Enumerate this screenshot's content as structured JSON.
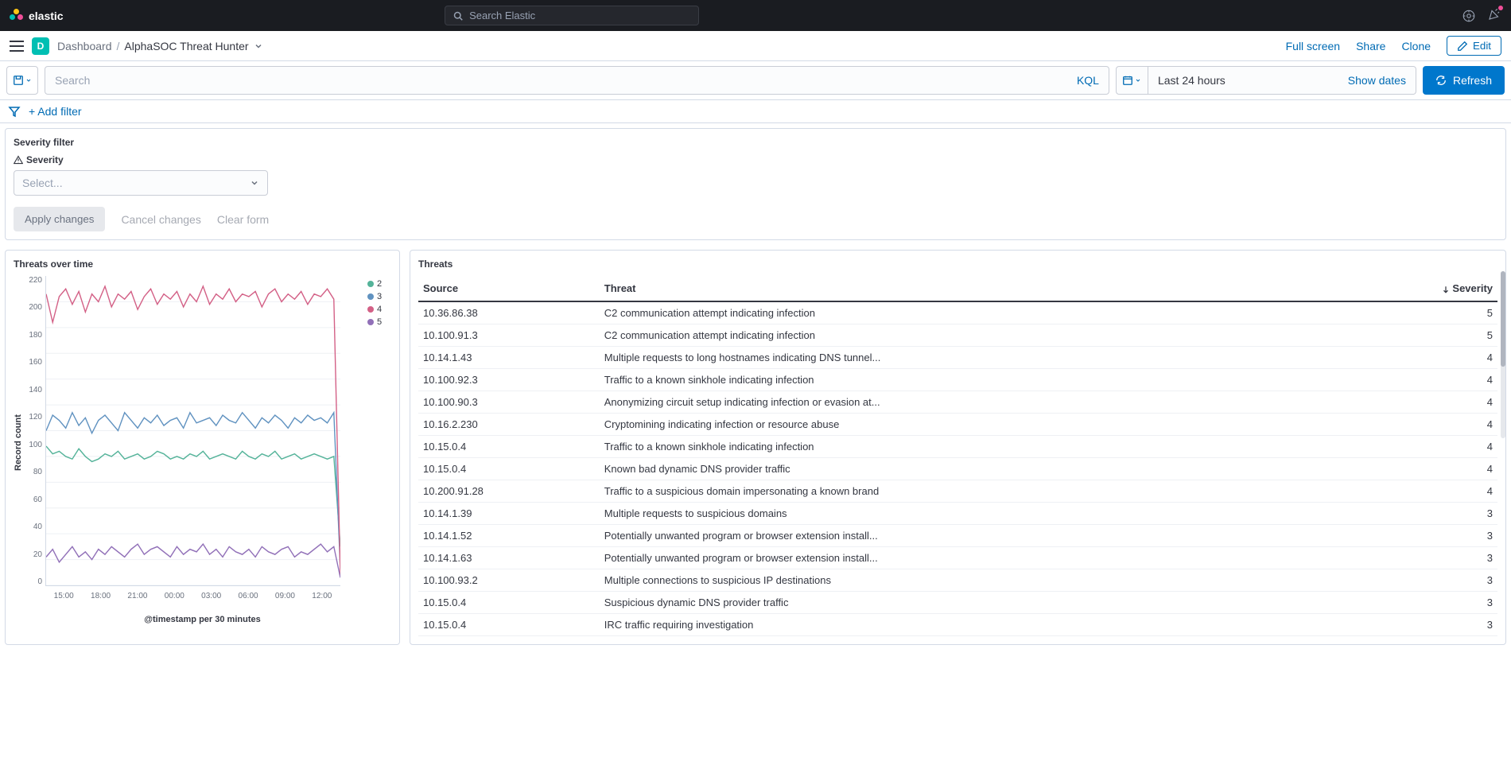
{
  "brand": "elastic",
  "top_search_placeholder": "Search Elastic",
  "space_letter": "D",
  "breadcrumb": {
    "dashboard": "Dashboard",
    "title": "AlphaSOC Threat Hunter"
  },
  "actions": {
    "fullscreen": "Full screen",
    "share": "Share",
    "clone": "Clone",
    "edit": "Edit"
  },
  "query": {
    "placeholder": "Search",
    "lang": "KQL"
  },
  "date": {
    "range": "Last 24 hours",
    "show": "Show dates"
  },
  "refresh": "Refresh",
  "add_filter": "+ Add filter",
  "severity_panel": {
    "title": "Severity filter",
    "label": "Severity",
    "placeholder": "Select...",
    "apply": "Apply changes",
    "cancel": "Cancel changes",
    "clear": "Clear form"
  },
  "chart_panel": {
    "title": "Threats over time",
    "ylabel": "Record count",
    "xlabel": "@timestamp per 30 minutes"
  },
  "threats_panel": {
    "title": "Threats",
    "columns": {
      "source": "Source",
      "threat": "Threat",
      "severity": "Severity"
    },
    "rows": [
      {
        "source": "10.36.86.38",
        "threat": "C2 communication attempt indicating infection",
        "severity": 5
      },
      {
        "source": "10.100.91.3",
        "threat": "C2 communication attempt indicating infection",
        "severity": 5
      },
      {
        "source": "10.14.1.43",
        "threat": "Multiple requests to long hostnames indicating DNS tunnel...",
        "severity": 4
      },
      {
        "source": "10.100.92.3",
        "threat": "Traffic to a known sinkhole indicating infection",
        "severity": 4
      },
      {
        "source": "10.100.90.3",
        "threat": "Anonymizing circuit setup indicating infection or evasion at...",
        "severity": 4
      },
      {
        "source": "10.16.2.230",
        "threat": "Cryptomining indicating infection or resource abuse",
        "severity": 4
      },
      {
        "source": "10.15.0.4",
        "threat": "Traffic to a known sinkhole indicating infection",
        "severity": 4
      },
      {
        "source": "10.15.0.4",
        "threat": "Known bad dynamic DNS provider traffic",
        "severity": 4
      },
      {
        "source": "10.200.91.28",
        "threat": "Traffic to a suspicious domain impersonating a known brand",
        "severity": 4
      },
      {
        "source": "10.14.1.39",
        "threat": "Multiple requests to suspicious domains",
        "severity": 3
      },
      {
        "source": "10.14.1.52",
        "threat": "Potentially unwanted program or browser extension install...",
        "severity": 3
      },
      {
        "source": "10.14.1.63",
        "threat": "Potentially unwanted program or browser extension install...",
        "severity": 3
      },
      {
        "source": "10.100.93.2",
        "threat": "Multiple connections to suspicious IP destinations",
        "severity": 3
      },
      {
        "source": "10.15.0.4",
        "threat": "Suspicious dynamic DNS provider traffic",
        "severity": 3
      },
      {
        "source": "10.15.0.4",
        "threat": "IRC traffic requiring investigation",
        "severity": 3
      }
    ]
  },
  "chart_data": {
    "type": "line",
    "xlabel": "@timestamp per 30 minutes",
    "ylabel": "Record count",
    "ylim": [
      0,
      240
    ],
    "x_ticks": [
      "15:00",
      "18:00",
      "21:00",
      "00:00",
      "03:00",
      "06:00",
      "09:00",
      "12:00"
    ],
    "y_ticks": [
      0,
      20,
      40,
      60,
      80,
      100,
      120,
      140,
      160,
      180,
      200,
      220
    ],
    "legend": [
      {
        "name": "2",
        "color": "#54b399"
      },
      {
        "name": "3",
        "color": "#6092c0"
      },
      {
        "name": "4",
        "color": "#d36086"
      },
      {
        "name": "5",
        "color": "#9170b8"
      }
    ],
    "series": [
      {
        "name": "2",
        "color": "#54b399",
        "values": [
          108,
          102,
          104,
          100,
          98,
          106,
          100,
          96,
          98,
          102,
          100,
          104,
          98,
          100,
          102,
          98,
          100,
          104,
          102,
          98,
          100,
          98,
          102,
          100,
          104,
          98,
          100,
          102,
          100,
          98,
          104,
          100,
          98,
          102,
          100,
          104,
          98,
          100,
          102,
          98,
          100,
          102,
          100,
          98,
          100,
          30
        ]
      },
      {
        "name": "3",
        "color": "#6092c0",
        "values": [
          120,
          132,
          128,
          122,
          134,
          124,
          130,
          118,
          128,
          132,
          126,
          120,
          134,
          128,
          122,
          130,
          126,
          132,
          124,
          128,
          130,
          122,
          134,
          126,
          128,
          130,
          124,
          132,
          128,
          126,
          134,
          128,
          122,
          130,
          126,
          132,
          128,
          122,
          130,
          126,
          132,
          128,
          130,
          126,
          134,
          12
        ]
      },
      {
        "name": "4",
        "color": "#d36086",
        "values": [
          226,
          204,
          224,
          230,
          218,
          228,
          212,
          226,
          220,
          232,
          216,
          226,
          222,
          228,
          214,
          224,
          230,
          218,
          226,
          222,
          228,
          216,
          226,
          220,
          232,
          218,
          226,
          222,
          230,
          220,
          226,
          224,
          228,
          216,
          226,
          230,
          220,
          226,
          222,
          228,
          218,
          226,
          224,
          230,
          222,
          8
        ]
      },
      {
        "name": "5",
        "color": "#9170b8",
        "values": [
          22,
          28,
          18,
          24,
          30,
          22,
          26,
          20,
          28,
          24,
          30,
          26,
          22,
          28,
          32,
          24,
          28,
          30,
          26,
          22,
          30,
          24,
          28,
          26,
          32,
          24,
          28,
          22,
          30,
          26,
          24,
          28,
          22,
          30,
          26,
          24,
          28,
          30,
          22,
          26,
          24,
          28,
          32,
          26,
          30,
          6
        ]
      }
    ]
  }
}
